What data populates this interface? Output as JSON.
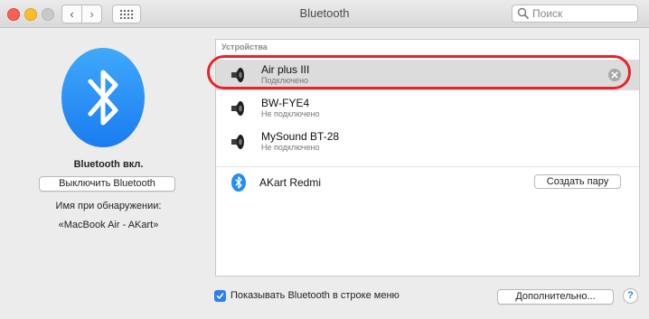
{
  "window": {
    "title": "Bluetooth",
    "search_placeholder": "Поиск"
  },
  "left": {
    "status": "Bluetooth вкл.",
    "toggle_button": "Выключить Bluetooth",
    "discoverable_label": "Имя при обнаружении:",
    "discoverable_name": "«MacBook Air - AKart»"
  },
  "devices": {
    "section_title": "Устройства",
    "items": [
      {
        "name": "Air plus III",
        "status": "Подключено",
        "selected": true,
        "icon": "speaker-icon"
      },
      {
        "name": "BW-FYE4",
        "status": "Не подключено",
        "icon": "speaker-icon"
      },
      {
        "name": "MySound BT-28",
        "status": "Не подключено",
        "icon": "speaker-icon"
      }
    ],
    "nearby": [
      {
        "name": "AKart Redmi",
        "pair_button": "Создать пару",
        "icon": "bluetooth-icon"
      }
    ]
  },
  "footer": {
    "show_in_menu_label": "Показывать Bluetooth в строке меню",
    "show_in_menu_checked": true,
    "advanced_button": "Дополнительно...",
    "help": "?"
  },
  "colors": {
    "accent": "#2c7ef5",
    "highlight": "#e8232a",
    "bluetooth_blue": "#1f8cf8"
  }
}
